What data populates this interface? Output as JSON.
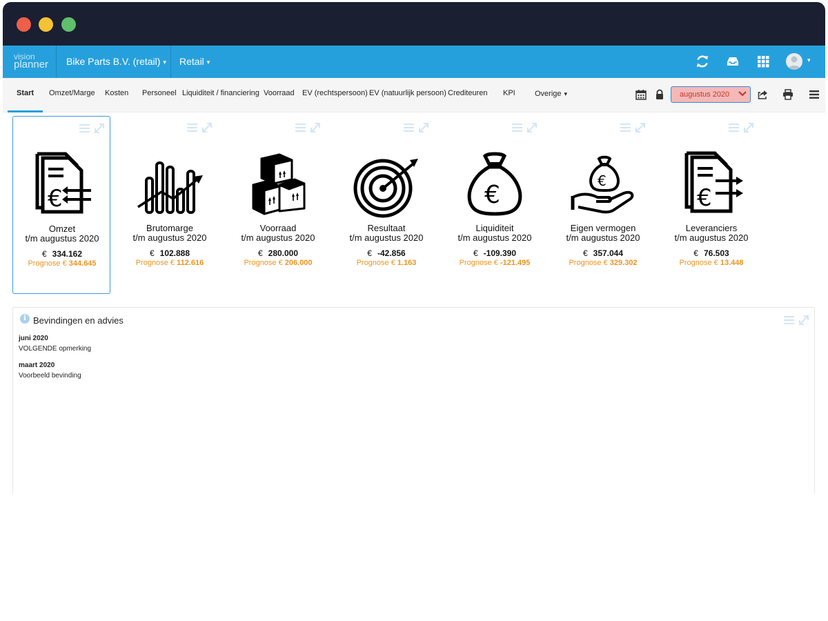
{
  "app": {
    "logo_line1": "vision",
    "logo_line2": "planner",
    "company": "Bike Parts B.V. (retail)",
    "module": "Retail"
  },
  "icons": {
    "header": [
      "refresh-icon",
      "inbox-icon",
      "apps-grid-icon",
      "user-avatar-icon"
    ],
    "toolbar": [
      "calendar-icon",
      "lock-icon",
      "share-icon",
      "print-icon",
      "menu-icon"
    ]
  },
  "tabs": [
    {
      "label": "Start",
      "active": true
    },
    {
      "label": "Omzet/Marge"
    },
    {
      "label": "Kosten"
    },
    {
      "label": "Personeel"
    },
    {
      "label": "Liquiditeit / financiering"
    },
    {
      "label": "Voorraad"
    },
    {
      "label": "EV (rechtspersoon)"
    },
    {
      "label": "EV (natuurlijk persoon)"
    },
    {
      "label": "Crediteuren"
    },
    {
      "label": "KPI"
    },
    {
      "label": "Overige"
    }
  ],
  "period": {
    "selected": "augustus 2020"
  },
  "currency": "€",
  "prognose_label": "Prognose €",
  "cards": [
    {
      "title": "Omzet",
      "subtitle": "t/m augustus 2020",
      "value": "334.162",
      "prognose": "344.645",
      "icon": "revenue-document-icon"
    },
    {
      "title": "Brutomarge",
      "subtitle": "t/m augustus 2020",
      "value": "102.888",
      "prognose": "112.616",
      "icon": "bar-trend-icon"
    },
    {
      "title": "Voorraad",
      "subtitle": "t/m augustus 2020",
      "value": "280.000",
      "prognose": "206.000",
      "icon": "boxes-icon"
    },
    {
      "title": "Resultaat",
      "subtitle": "t/m augustus 2020",
      "value": "-42.856",
      "prognose": "1.163",
      "icon": "target-icon"
    },
    {
      "title": "Liquiditeit",
      "subtitle": "t/m augustus 2020",
      "value": "-109.390",
      "prognose": "-121.495",
      "icon": "money-bag-icon"
    },
    {
      "title": "Eigen vermogen",
      "subtitle": "t/m augustus 2020",
      "value": "357.044",
      "prognose": "329.302",
      "icon": "hand-money-icon"
    },
    {
      "title": "Leveranciers",
      "subtitle": "t/m augustus 2020",
      "value": "76.503",
      "prognose": "13.448",
      "icon": "supplier-document-icon"
    }
  ],
  "findings": {
    "title": "Bevindingen en advies",
    "entries": [
      {
        "date": "juni 2020",
        "text": "VOLGENDE opmerking"
      },
      {
        "date": "maart 2020",
        "text": "Voorbeeld bevinding"
      }
    ]
  },
  "colors": {
    "titlebar": "#1b1f32",
    "appbar": "#26a0dc",
    "accent": "#26a0dc",
    "prognose": "#f0921c",
    "period_bg": "#f5b8b8"
  }
}
